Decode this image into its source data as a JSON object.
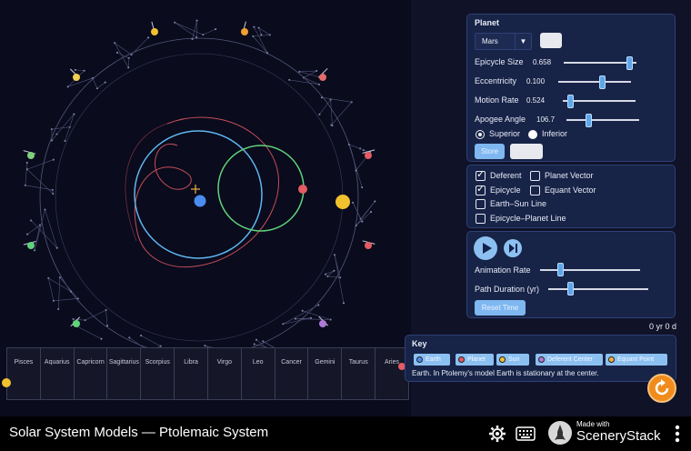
{
  "app": {
    "title": "Solar System Models — Ptolemaic System",
    "made_with": "Made with",
    "brand": "SceneryStack"
  },
  "time_readout": "0 yr 0 d",
  "zodiac": [
    "Pisces",
    "Aquarius",
    "Capricorn",
    "Sagittarius",
    "Scorpius",
    "Libra",
    "Virgo",
    "Leo",
    "Cancer",
    "Gemini",
    "Taurus",
    "Aries"
  ],
  "planet_panel": {
    "heading": "Planet",
    "selected_planet": "Mars",
    "sliders": [
      {
        "label": "Epicycle Size",
        "value": "0.658",
        "level": 0.9
      },
      {
        "label": "Eccentricity",
        "value": "0.100",
        "level": 0.6
      },
      {
        "label": "Motion Rate",
        "value": "0.524",
        "level": 0.1
      },
      {
        "label": "Apogee Angle",
        "value": "106.7",
        "level": 0.3
      }
    ],
    "radio_superior": "Superior",
    "radio_inferior": "Inferior",
    "store_button": "Store"
  },
  "visibility_panel": {
    "checkboxes": [
      {
        "label": "Deferent",
        "checked": true
      },
      {
        "label": "Planet Vector",
        "checked": false
      },
      {
        "label": "Epicycle",
        "checked": true
      },
      {
        "label": "Equant Vector",
        "checked": false
      },
      {
        "label": "Earth–Sun Line",
        "checked": false
      },
      {
        "label": "Epicycle–Planet Line",
        "checked": false
      }
    ]
  },
  "animation_panel": {
    "animation_rate_label": "Animation Rate",
    "animation_rate_level": 0.2,
    "path_duration_label": "Path Duration (yr)",
    "path_duration_level": 0.22,
    "reset_time": "Reset Time"
  },
  "key_panel": {
    "heading": "Key",
    "chips": [
      {
        "label": "Earth",
        "color": "#4a8cf0"
      },
      {
        "label": "Planet",
        "color": "#e35b63"
      },
      {
        "label": "Sun",
        "color": "#f2c12e"
      },
      {
        "label": "Deferent Center",
        "color": "#b07ad8"
      },
      {
        "label": "Equant Point",
        "color": "#f0b040"
      }
    ],
    "description": "Earth. In Ptolemy's model Earth is stationary at the center."
  },
  "colors": {
    "earth": "#4a8cf0",
    "planet": "#e35b63",
    "sun": "#f2c12e",
    "deferent": "#5fb7f0",
    "epicycle": "#5fd27a",
    "path": "#e35b63",
    "reset_button": "#f08b1c"
  },
  "icons": {
    "play": "play-icon",
    "step": "step-forward-icon",
    "reset": "reset-all-icon",
    "settings": "gear-icon",
    "keyboard": "keyboard-icon",
    "menu": "kebab-menu-icon",
    "dropdown": "triangle-down-icon"
  }
}
